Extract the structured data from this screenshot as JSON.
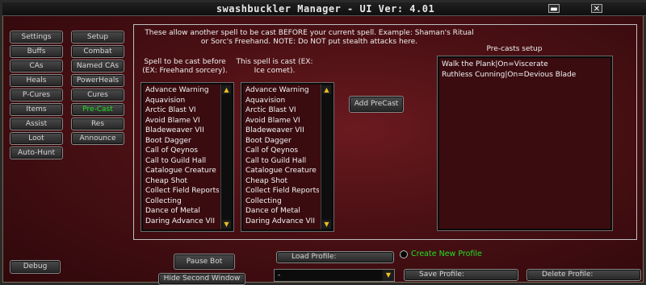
{
  "window": {
    "title": "swashbuckler Manager  - UI Ver: 4.01",
    "minimize_icon": "minimize-icon",
    "close_icon": "close-icon"
  },
  "sidebar": {
    "left": [
      "Settings",
      "Buffs",
      "CAs",
      "Heals",
      "P-Cures",
      "Items",
      "Assist",
      "Loot",
      "Auto-Hunt"
    ],
    "right": [
      "Setup",
      "Combat",
      "Named CAs",
      "PowerHeals",
      "Cures",
      "Pre-Cast",
      "Res",
      "Announce"
    ],
    "active": "Pre-Cast",
    "debug_label": "Debug"
  },
  "colors": {
    "active_tab": "#24e024",
    "create_profile": "#24e024"
  },
  "precast": {
    "description": "These allow another spell to be cast BEFORE your current spell. Example: Shaman's Ritual or Sorc's Freehand. NOTE: Do NOT put stealth attacks here.",
    "list1_header": "Spell to be cast before (EX: Freehand sorcery).",
    "list2_header": "This spell is cast (EX: Ice comet).",
    "list_items": [
      "Advance Warning",
      "Aquavision",
      "Arctic Blast VI",
      "Avoid Blame VI",
      "Bladeweaver VII",
      "Boot Dagger",
      "Call of Qeynos",
      "Call to Guild Hall",
      "Catalogue Creature",
      "Cheap Shot",
      "Collect Field Reports",
      "Collecting",
      "Dance of Metal",
      "Daring Advance VII"
    ],
    "add_button": "Add PreCast",
    "setup_header": "Pre-casts setup",
    "setup_items": [
      "Walk the Plank|On=Viscerate",
      "Ruthless Cunning|On=Devious Blade"
    ]
  },
  "bottom": {
    "pause": "Pause Bot",
    "hide": "Hide Second Window",
    "load": "Load Profile:",
    "create": "Create New Profile",
    "profile_value": "-",
    "save": "Save Profile:",
    "delete": "Delete Profile:"
  }
}
